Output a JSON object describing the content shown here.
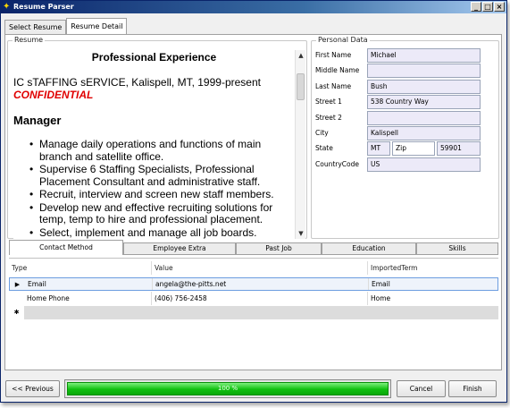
{
  "window": {
    "title": "Resume Parser",
    "controls": {
      "minimize": "_",
      "maximize": "□",
      "close": "×"
    }
  },
  "top_tabs": [
    {
      "label": "Select Resume",
      "active": false
    },
    {
      "label": "Resume Detail",
      "active": true
    }
  ],
  "resume": {
    "group_title": "Resume",
    "heading": "Professional Experience",
    "company_line": "IC sTAFFING sERVICE, Kalispell, MT, 1999-present",
    "confidential": "CONFIDENTIAL",
    "role": "Manager",
    "bullets": [
      "Manage daily operations and functions of main branch and satellite office.",
      "Supervise 6 Staffing Specialists, Professional Placement Consultant and administrative staff.",
      "Recruit, interview and screen new staff members.",
      "Develop new and effective recruiting solutions for temp, temp to hire and professional placement.",
      "Select, implement and manage all job boards."
    ]
  },
  "personal": {
    "group_title": "Personal Data",
    "first_name": {
      "label": "First Name",
      "value": "Michael"
    },
    "middle_name": {
      "label": "Middle Name",
      "value": ""
    },
    "last_name": {
      "label": "Last Name",
      "value": "Bush"
    },
    "street1": {
      "label": "Street 1",
      "value": "538 Country Way"
    },
    "street2": {
      "label": "Street 2",
      "value": ""
    },
    "city": {
      "label": "City",
      "value": "Kalispell"
    },
    "state": {
      "label": "State",
      "value": "MT"
    },
    "zip": {
      "label": "Zip",
      "value": "59901"
    },
    "country": {
      "label": "CountryCode",
      "value": "US"
    }
  },
  "bottom_tabs": [
    {
      "label": "Contact Method",
      "active": true
    },
    {
      "label": "Employee Extra",
      "active": false
    },
    {
      "label": "Past Job",
      "active": false
    },
    {
      "label": "Education",
      "active": false
    },
    {
      "label": "Skills",
      "active": false
    }
  ],
  "grid": {
    "columns": [
      "Type",
      "Value",
      "ImportedTerm"
    ],
    "rows": [
      {
        "type": "Email",
        "value": "angela@the-pitts.net",
        "term": "Email",
        "selected": true
      },
      {
        "type": "Home Phone",
        "value": "(406) 756-2458",
        "term": "Home",
        "selected": false
      }
    ],
    "current_row_marker": "▶",
    "new_row_marker": "✱"
  },
  "footer": {
    "previous": "<< Previous",
    "progress_percent": 100,
    "progress_label": "100 %",
    "cancel": "Cancel",
    "finish": "Finish"
  },
  "colors": {
    "titlebar": "#0a246a",
    "input_bg": "#eceaf8",
    "progress": "#10c010",
    "confidential": "#e00000"
  }
}
